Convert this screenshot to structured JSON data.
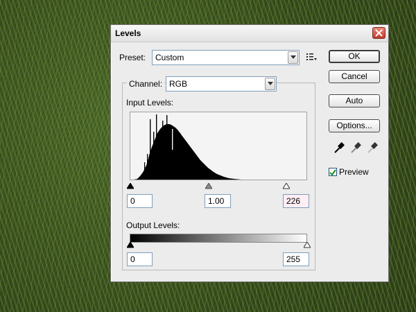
{
  "dialog": {
    "title": "Levels",
    "preset_label": "Preset:",
    "preset_value": "Custom",
    "channel_label": "Channel:",
    "channel_value": "RGB",
    "input_levels_label": "Input Levels:",
    "output_levels_label": "Output Levels:",
    "input_black": "0",
    "input_gamma": "1.00",
    "input_white": "226",
    "output_black": "0",
    "output_white": "255",
    "buttons": {
      "ok": "OK",
      "cancel": "Cancel",
      "auto": "Auto",
      "options": "Options..."
    },
    "preview_label": "Preview",
    "preview_checked": true
  },
  "icons": [
    "close-icon",
    "preset-menu-icon",
    "black-eyedropper-icon",
    "gray-eyedropper-icon",
    "white-eyedropper-icon"
  ],
  "colors": {
    "close": "#c0392b",
    "input_white_bg": "#ffeef3"
  }
}
